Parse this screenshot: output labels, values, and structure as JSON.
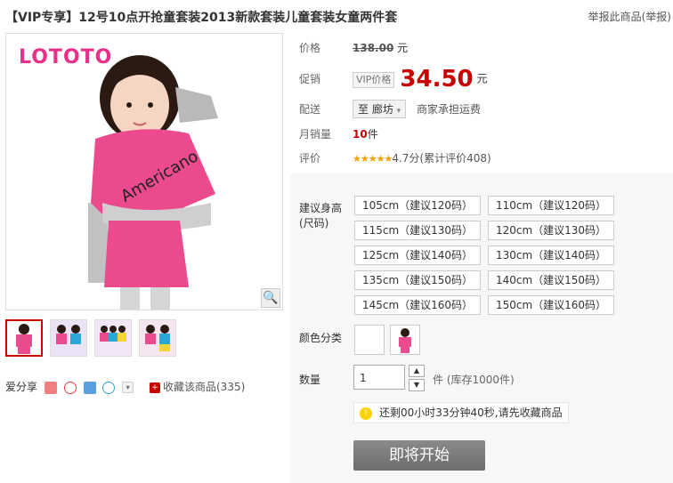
{
  "title": "【VIP专享】12号10点开抢童套装2013新款套装儿童套装女童两件套",
  "report": "举报此商品(举报)",
  "logo": "LOTOTO",
  "shirt_text": "Americano",
  "labels": {
    "price": "价格",
    "promo": "促销",
    "delivery": "配送",
    "monthly_sales": "月销量",
    "rating": "评价",
    "size": "建议身高",
    "size_sub": "(尺码)",
    "color": "颜色分类",
    "quantity": "数量"
  },
  "original_price": "138.00",
  "currency_unit": "元",
  "vip_tag": "VIP价格",
  "promo_price": "34.50",
  "delivery": {
    "to": "至 廊坊",
    "note": "商家承担运费"
  },
  "monthly_sales": {
    "value": "10",
    "unit": "件"
  },
  "rating": {
    "stars": 4.7,
    "text": "4.7分(累计评价408)"
  },
  "sizes": [
    "105cm（建议120码）",
    "110cm（建议120码）",
    "115cm（建议130码）",
    "120cm（建议130码）",
    "125cm（建议140码）",
    "130cm（建议140码）",
    "135cm（建议150码）",
    "140cm（建议150码）",
    "145cm（建议160码）",
    "150cm（建议160码）"
  ],
  "quantity": {
    "value": "1",
    "stock": "件 (库存1000件)"
  },
  "tip": "还剩00小时33分钟40秒,请先收藏商品",
  "buy_button": "即将开始",
  "share": {
    "label": "爱分享"
  },
  "favorite": "收藏该商品(335)",
  "colors": {
    "price_red": "#c80000",
    "brand_pink": "#e8308a",
    "star": "#f5a100"
  }
}
